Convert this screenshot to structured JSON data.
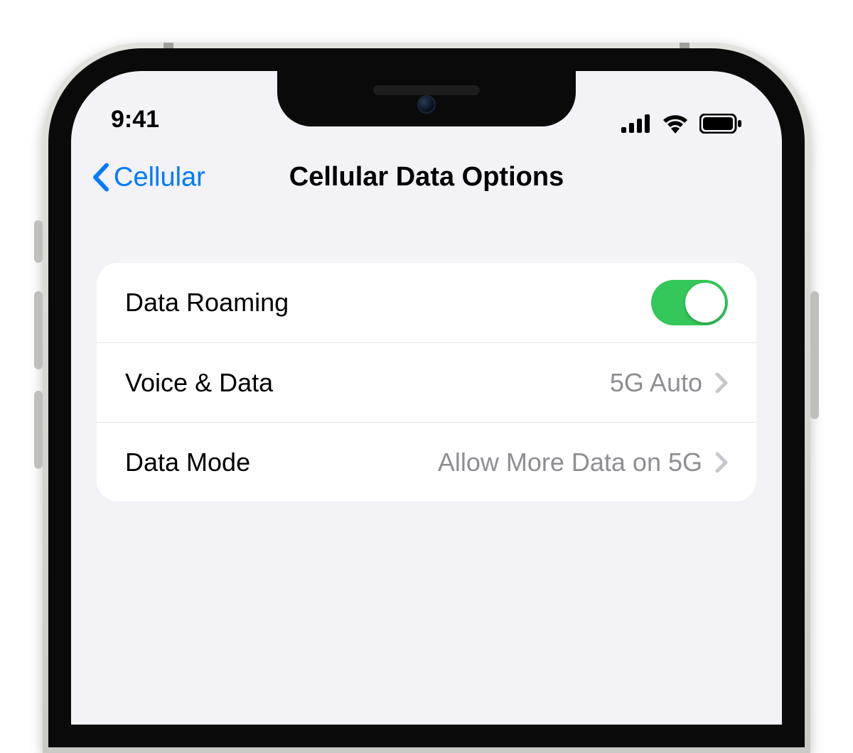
{
  "statusbar": {
    "time": "9:41"
  },
  "nav": {
    "back_label": "Cellular",
    "title": "Cellular Data Options"
  },
  "settings": {
    "rows": [
      {
        "label": "Data Roaming",
        "value": "",
        "type": "toggle",
        "on": true
      },
      {
        "label": "Voice & Data",
        "value": "5G Auto",
        "type": "link"
      },
      {
        "label": "Data Mode",
        "value": "Allow More Data on 5G",
        "type": "link"
      }
    ]
  }
}
